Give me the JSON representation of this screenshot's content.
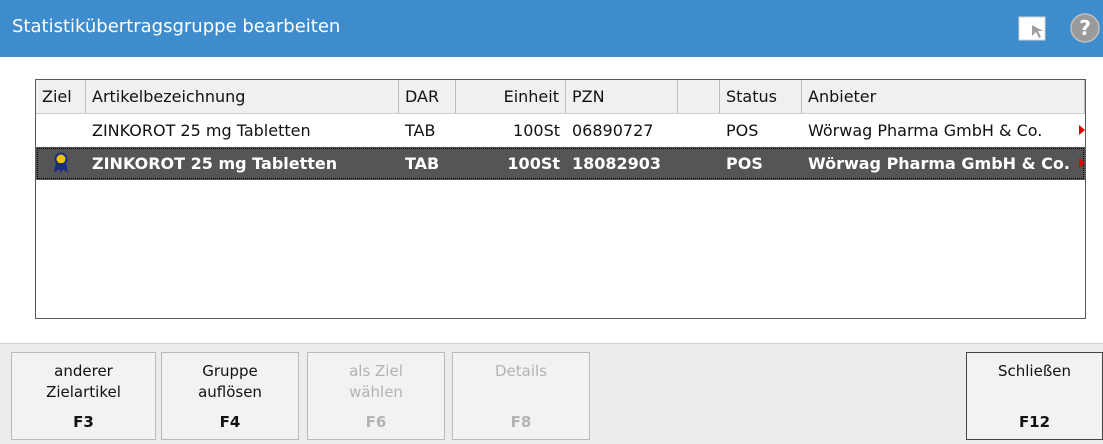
{
  "window": {
    "title": "Statistikübertragsgruppe bearbeiten",
    "icons": [
      "document-arrow-icon",
      "help-icon"
    ]
  },
  "table": {
    "columns": [
      "Ziel",
      "Artikelbezeichnung",
      "DAR",
      "Einheit",
      "PZN",
      "",
      "Status",
      "Anbieter"
    ],
    "rows": [
      {
        "ziel": "",
        "artikel": "ZINKOROT 25 mg Tabletten",
        "dar": "TAB",
        "einheit": "100St",
        "pzn": "06890727",
        "extra": "",
        "status": "POS",
        "anbieter": "Wörwag Pharma GmbH & Co.",
        "selected": false
      },
      {
        "ziel": "target-marker-icon",
        "artikel": "ZINKOROT 25 mg Tabletten",
        "dar": "TAB",
        "einheit": "100St",
        "pzn": "18082903",
        "extra": "",
        "status": "POS",
        "anbieter": "Wörwag Pharma GmbH & Co.",
        "selected": true
      }
    ]
  },
  "buttons": {
    "anderer": {
      "label1": "anderer",
      "label2": "Zielartikel",
      "key": "F3",
      "enabled": true
    },
    "gruppe": {
      "label1": "Gruppe",
      "label2": "auflösen",
      "key": "F4",
      "enabled": true
    },
    "ziel": {
      "label1": "als Ziel",
      "label2": "wählen",
      "key": "F6",
      "enabled": false
    },
    "details": {
      "label1": "Details",
      "label2": "",
      "key": "F8",
      "enabled": false
    },
    "schliessen": {
      "label1": "Schließen",
      "label2": "",
      "key": "F12",
      "enabled": true
    }
  },
  "colors": {
    "titlebar": "#3f8ccc",
    "selected_row": "#555555",
    "overflow_arrow": "#e00000"
  }
}
